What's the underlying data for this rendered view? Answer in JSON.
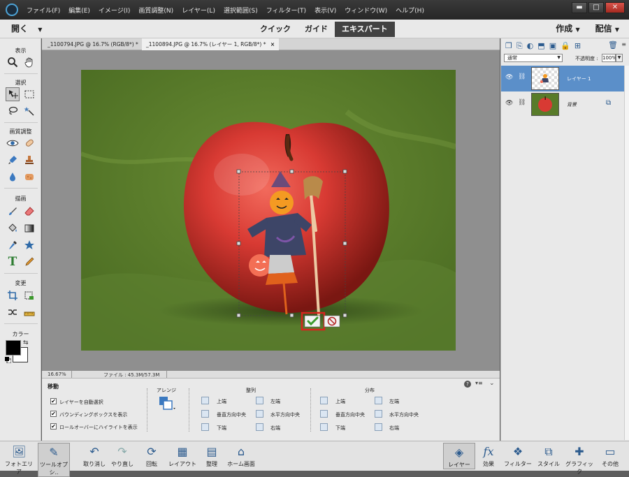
{
  "menubar": {
    "items": [
      "ファイル(F)",
      "編集(E)",
      "イメージ(I)",
      "画質調整(N)",
      "レイヤー(L)",
      "選択範囲(S)",
      "フィルター(T)",
      "表示(V)",
      "ウィンドウ(W)",
      "ヘルプ(H)"
    ],
    "minimize": "▬",
    "maximize": "□",
    "close": "✕"
  },
  "modebar": {
    "open_label": "開く",
    "tabs": [
      "クイック",
      "ガイド",
      "エキスパート"
    ],
    "active_tab": "エキスパート",
    "create_label": "作成",
    "share_label": "配信"
  },
  "tools": {
    "sections": [
      "表示",
      "選択",
      "画質調整",
      "描画",
      "変更",
      "カラー"
    ]
  },
  "doc_tabs": [
    {
      "label": "_1100794.JPG @ 16.7% (RGB/8*) *",
      "close": "×"
    },
    {
      "label": "_1100894.JPG @ 16.7% (レイヤー 1, RGB/8*) *",
      "close": "×"
    }
  ],
  "status": {
    "zoom": "16.67%",
    "file": "ファイル : 45.3M/57.3M"
  },
  "options": {
    "title": "移動",
    "checkboxes": [
      "レイヤーを自動選択",
      "バウンディングボックスを表示",
      "ロールオーバーにハイライトを表示"
    ],
    "arrange_label": "アレンジ",
    "align_label": "整列",
    "distribute_label": "分布",
    "align": [
      "上端",
      "垂直方向中央",
      "下端",
      "左端",
      "水平方向中央",
      "右端"
    ],
    "distribute": [
      "上端",
      "垂直方向中央",
      "下端",
      "左端",
      "水平方向中央",
      "右端"
    ]
  },
  "layers": {
    "blend_mode": "通常",
    "opacity_label": "不透明度 :",
    "opacity_value": "100%",
    "items": [
      {
        "name": "レイヤー 1",
        "selected": true
      },
      {
        "name": "背景",
        "selected": false
      }
    ]
  },
  "bottombar": {
    "left": [
      "フォトエリア",
      "ツールオプシ..",
      "取り消し",
      "やり直し",
      "回転",
      "レイアウト",
      "整理",
      "ホーム画面"
    ],
    "right": [
      "レイヤー",
      "効果",
      "フィルター",
      "スタイル",
      "グラフィック",
      "その他"
    ]
  },
  "colors": {
    "accent": "#5b8fc9",
    "commit": "#3d9a2d",
    "highlight_box": "#d9231e"
  }
}
